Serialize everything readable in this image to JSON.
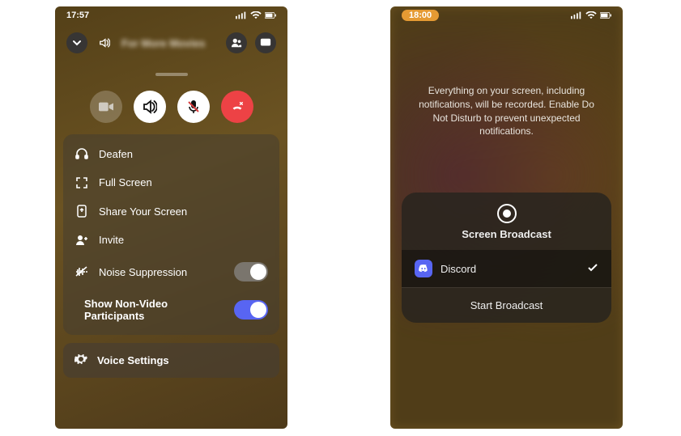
{
  "left": {
    "time": "17:57",
    "channel": "For More Movies",
    "options": {
      "deafen": "Deafen",
      "fullscreen": "Full Screen",
      "share": "Share Your Screen",
      "invite": "Invite",
      "noise": "Noise Suppression",
      "shownv": "Show Non-Video Participants"
    },
    "voice_settings": "Voice Settings"
  },
  "right": {
    "time": "18:00",
    "overlay": "Everything on your screen, including notifications, will be recorded. Enable Do Not Disturb to prevent unexpected notifications.",
    "broadcast_title": "Screen Broadcast",
    "app": "Discord",
    "start": "Start Broadcast"
  }
}
